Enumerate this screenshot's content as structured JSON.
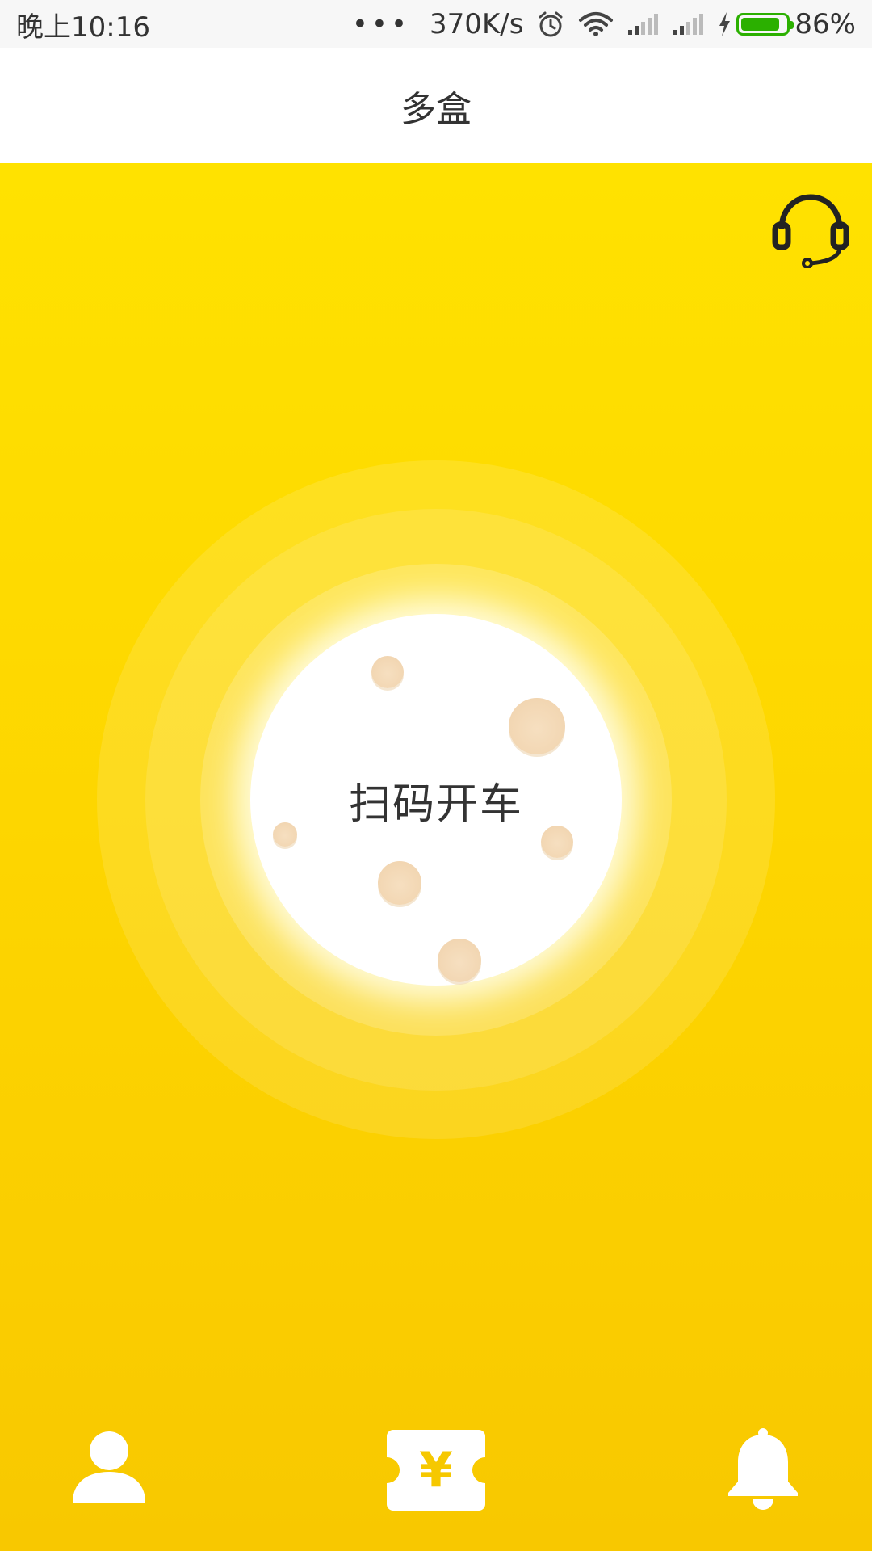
{
  "status_bar": {
    "time": "晚上10:16",
    "more": "•••",
    "speed": "370K/s",
    "battery_percent": "86%",
    "battery_level": 0.86,
    "icons": [
      "alarm-icon",
      "wifi-icon",
      "signal-icon",
      "signal-icon",
      "charging-icon",
      "battery-icon"
    ]
  },
  "app_bar": {
    "title": "多盒"
  },
  "main": {
    "support_icon": "headset-icon",
    "scan_button_label": "扫码开车"
  },
  "bottom_nav": {
    "items": [
      {
        "icon": "user-icon"
      },
      {
        "icon": "coupon-icon",
        "symbol": "¥"
      },
      {
        "icon": "bell-icon"
      }
    ]
  },
  "colors": {
    "primary_yellow": "#FFE000",
    "deep_yellow": "#F8C800",
    "battery_green": "#2BB000",
    "text_dark": "#333333"
  }
}
